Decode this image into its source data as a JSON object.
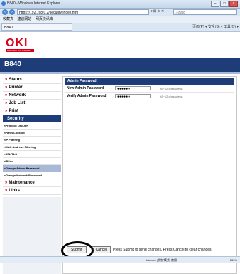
{
  "browser": {
    "title": "B840 - Windows Internet Explorer",
    "url": "https://192.168.0.2/security/index.htm",
    "search_placeholder": "Bing",
    "favorites_label": "收藏夹",
    "fav_item1": "建议网站",
    "fav_item2": "网页快讯库",
    "tab_label": "B840",
    "command_bar": "页面(P) ▾  安全(S) ▾  工具(O) ▾",
    "status_zone": "Internet | 保护模式: 禁用",
    "zoom": "100%"
  },
  "brand": {
    "logo": "OKI",
    "tagline": "PRINTING SOLUTIONS",
    "model": "B840"
  },
  "sidebar": {
    "items": [
      {
        "label": "Status"
      },
      {
        "label": "Printer"
      },
      {
        "label": "Network"
      },
      {
        "label": "Job List"
      },
      {
        "label": "Print"
      }
    ],
    "section_header": "Security",
    "sub_items": [
      {
        "label": "Protocol ON/OFF"
      },
      {
        "label": "Panel Lockout"
      },
      {
        "label": "IP Filtering"
      },
      {
        "label": "MAC Address Filtering"
      },
      {
        "label": "SSL/TLS"
      },
      {
        "label": "IPSec"
      },
      {
        "label": "Change Admin Password"
      },
      {
        "label": "Change Network Password"
      }
    ],
    "after_items": [
      {
        "label": "Maintenance"
      },
      {
        "label": "Links"
      }
    ]
  },
  "panel": {
    "title": "Admin Password",
    "rows": [
      {
        "label": "New Admin Password",
        "value": "●●●●●●",
        "hint": "(6~12 characters)"
      },
      {
        "label": "Verify Admin Password",
        "value": "●●●●●●",
        "hint": "(6~12 characters)"
      }
    ]
  },
  "footer": {
    "submit": "Submit",
    "cancel": "Cancel",
    "instructions": "Press Submit to send changes. Press Cancel to clear changes."
  }
}
